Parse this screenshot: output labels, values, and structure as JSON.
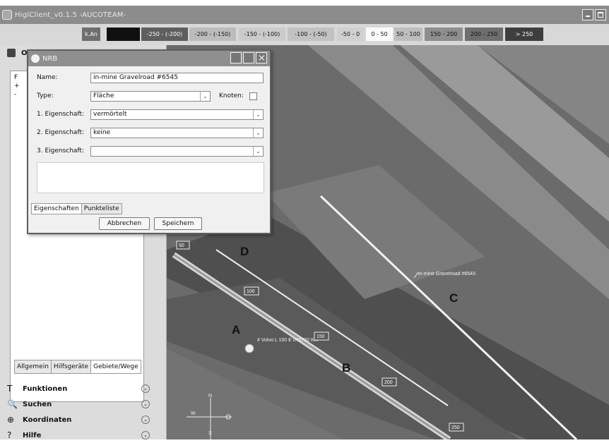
{
  "window": {
    "title": "HiglClient_v0.1.5 -AUCOTEAM-"
  },
  "legend": [
    {
      "label": "k.An",
      "bg": "#6e6e6e",
      "color": "#fff"
    },
    {
      "label": "",
      "bg": "#101010",
      "color": "#fff"
    },
    {
      "label": "-250 - (-200)",
      "bg": "#5e5e5e",
      "color": "#fff"
    },
    {
      "label": "-200 - (-150)",
      "bg": "#bcbcbc",
      "color": "#111"
    },
    {
      "label": "-150 - (-100)",
      "bg": "#cbcbcb",
      "color": "#111"
    },
    {
      "label": "-100 - (-50)",
      "bg": "#c2c2c2",
      "color": "#111"
    },
    {
      "label": "-50 - 0",
      "bg": "#d0d0d0",
      "color": "#111"
    },
    {
      "label": "0 - 50",
      "bg": "#fafafa",
      "color": "#111"
    },
    {
      "label": "50 - 100",
      "bg": "#bdbdbd",
      "color": "#111"
    },
    {
      "label": "150 - 200",
      "bg": "#8e8e8e",
      "color": "#111"
    },
    {
      "label": "200 - 250",
      "bg": "#6e6e6e",
      "color": "#111"
    },
    {
      "label": "> 250",
      "bg": "#3e3e3e",
      "color": "#fff"
    }
  ],
  "sidebar": {
    "header": "O",
    "tree": [
      "F",
      "+",
      "-"
    ],
    "tabs": [
      "Allgemein",
      "Hilfsgeräte",
      "Gebiete/Wege"
    ],
    "sections": [
      {
        "label": "Funktionen",
        "icon": "T"
      },
      {
        "label": "Suchen",
        "icon": "🔍"
      },
      {
        "label": "Koordinaten",
        "icon": "⊕"
      },
      {
        "label": "Hilfe",
        "icon": "?"
      }
    ]
  },
  "dialog": {
    "title": "NRB",
    "name_label": "Name:",
    "name_value": "in-mine Gravelroad #6545",
    "type_label": "Type:",
    "type_value": "Fläche",
    "knoten_label": "Knoten:",
    "prop1_label": "1. Eigenschaft:",
    "prop1_value": "vermörtelt",
    "prop2_label": "2. Eigenschaft:",
    "prop2_value": "keine",
    "prop3_label": "3. Eigenschaft:",
    "prop3_value": "",
    "tabs": [
      "Eigenschaften",
      "Punkteliste"
    ],
    "cancel": "Abbrechen",
    "save": "Speichern"
  },
  "map": {
    "labels": {
      "a": "A",
      "b": "B",
      "c": "C",
      "d": "D",
      "road_label": "in-mine Gravelroad #6543",
      "vehicle_label": "# Volvo L 150 E 078792 Km"
    },
    "distance_markers": [
      "50",
      "100",
      "150",
      "200",
      "250"
    ],
    "compass": {
      "n": "N",
      "w": "W",
      "s": "S"
    }
  }
}
